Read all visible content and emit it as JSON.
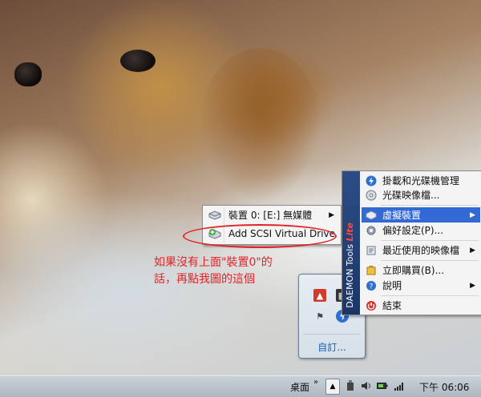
{
  "context_menu": {
    "items": [
      {
        "label": "裝置 0: [E:] 無媒體",
        "icon": "drive-icon",
        "has_submenu": true
      },
      {
        "label": "Add SCSI Virtual Drive",
        "icon": "add-drive-icon",
        "has_submenu": false
      }
    ]
  },
  "annotation": {
    "text": "如果沒有上面\"裝置0\"的話，再點我圖的這個",
    "color": "#e0242a"
  },
  "tray_popup": {
    "icons": [
      "red-app-icon",
      "dark-app-icon",
      "flag-icon",
      "daemon-tools-icon"
    ],
    "customize_label": "自訂..."
  },
  "daemon_menu": {
    "brand": "DAEMON Tools",
    "brand_edition": "Lite",
    "items": [
      {
        "label": "掛載和光碟機管理",
        "icon": "daemon-bolt-icon",
        "has_submenu": false
      },
      {
        "label": "光碟映像檔...",
        "icon": "disc-image-icon",
        "has_submenu": false
      },
      {
        "label": "虛擬裝置",
        "icon": "virtual-drive-icon",
        "has_submenu": true,
        "highlighted": true
      },
      {
        "label": "偏好設定(P)...",
        "icon": "preferences-icon",
        "has_submenu": false
      },
      {
        "label": "最近使用的映像檔",
        "icon": "recent-images-icon",
        "has_submenu": true
      },
      {
        "label": "立即購買(B)...",
        "icon": "buy-icon",
        "has_submenu": false
      },
      {
        "label": "說明",
        "icon": "help-icon",
        "has_submenu": true
      },
      {
        "label": "結束",
        "icon": "exit-icon",
        "has_submenu": false
      }
    ],
    "highlight_color": "#3369d4"
  },
  "taskbar": {
    "desktop_label": "桌面",
    "time": "下午 06:06"
  }
}
